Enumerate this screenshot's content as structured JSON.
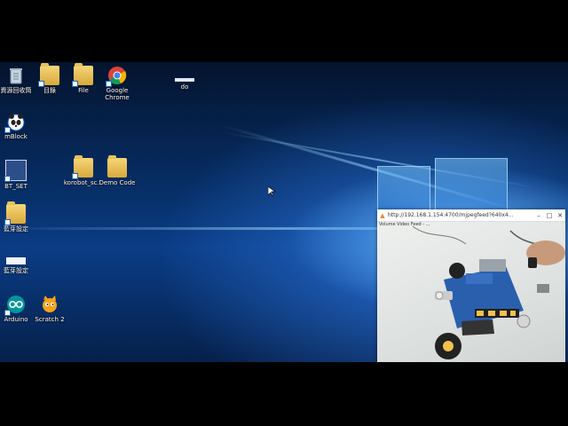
{
  "desktop": {
    "icons": [
      {
        "id": "recycle-bin",
        "label": "資源回收筒",
        "type": "recycle"
      },
      {
        "id": "folder-mulu",
        "label": "目錄",
        "type": "folder-shortcut"
      },
      {
        "id": "folder-file",
        "label": "File",
        "type": "folder-shortcut"
      },
      {
        "id": "google-chrome",
        "label": "Google\nChrome",
        "type": "chrome"
      },
      {
        "id": "do",
        "label": "do",
        "type": "blank"
      },
      {
        "id": "mblock",
        "label": "mBlock",
        "type": "mblock"
      },
      {
        "id": "bt-set",
        "label": "BT_SET",
        "type": "app"
      },
      {
        "id": "korobot",
        "label": "korobot_sc...",
        "type": "folder-shortcut"
      },
      {
        "id": "demo-code",
        "label": "Demo Code",
        "type": "folder"
      },
      {
        "id": "folder-b1",
        "label": "藍芽設定",
        "type": "folder-shortcut"
      },
      {
        "id": "blank-b2",
        "label": "藍芽設定",
        "type": "blank"
      },
      {
        "id": "arduino",
        "label": "Arduino",
        "type": "arduino"
      },
      {
        "id": "scratch2",
        "label": "Scratch 2",
        "type": "scratch"
      }
    ]
  },
  "browser": {
    "url": "http://192.168.1.154:4700/mjpegfeed?640x4...",
    "feed_overlay": "Volume Video Feed - ..."
  },
  "colors": {
    "accent": "#1a62c5",
    "titlebar": "#ffffff"
  }
}
